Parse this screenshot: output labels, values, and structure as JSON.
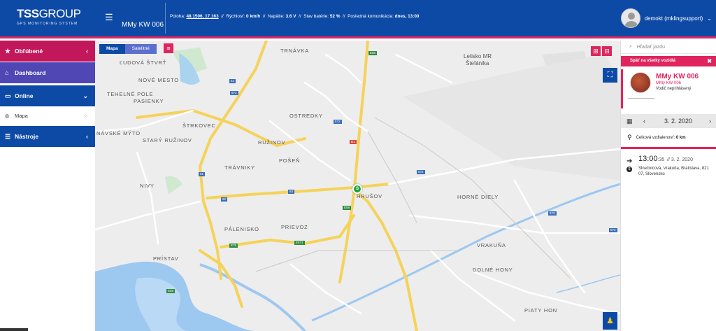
{
  "header": {
    "logo_main": "TSS",
    "logo_group": "GROUP",
    "logo_sub": "GPS MONITORING SYSTEM",
    "vehicle": "MMy KW 006",
    "status": {
      "poloha_label": "Poloha:",
      "poloha_value": "48.1506, 17.163",
      "rychlost_label": "Rýchlosť:",
      "rychlost_value": "0 km/h",
      "napatie_label": "Napätie:",
      "napatie_value": "3.6 V",
      "bateria_label": "Stav batérie:",
      "bateria_value": "52 %",
      "komunikacia_label": "Posledná komunikácia:",
      "komunikacia_value": "dnes, 13:00",
      "sep": "//"
    },
    "user": "demokt (mklingsupport)"
  },
  "sidebar": {
    "items": [
      {
        "label": "Obľúbené"
      },
      {
        "label": "Dashboard"
      },
      {
        "label": "Online"
      },
      {
        "label": "Mapa"
      },
      {
        "label": "Nástroje"
      }
    ]
  },
  "map": {
    "toggle_map": "Mapa",
    "toggle_sat": "Satelitné",
    "marker": "S",
    "labels": [
      "TRNÁVKA",
      "ĽUDOVÁ ŠTVRŤ",
      "NOVÉ MESTO",
      "TEHELNÉ POLE",
      "PASIENKY",
      "OSTREDKY",
      "ŠTRKOVEC",
      "NÁVSKÉ MÝTO",
      "STARÝ RUŽINOV",
      "RUŽINOV",
      "POŠEŇ",
      "TRÁVNIKY",
      "NIVY",
      "HRUŠOV",
      "HORNÉ DIELY",
      "PÁLENISKO",
      "PRIEVOZ",
      "PRÍSTAV",
      "VRAKUŇA",
      "DOLNÉ HONY",
      "PIATY HON",
      "Letisko MR",
      "Štefánika"
    ],
    "shields": [
      "E58",
      "61",
      "572",
      "63",
      "62",
      "E75",
      "E571",
      "E58",
      "572",
      "572",
      "572",
      "D1",
      "61",
      "572",
      "E58"
    ]
  },
  "right_panel": {
    "search_placeholder": "Hľadať jazdu",
    "spat": "Späť na všetky vozidlá",
    "vehicle_name": "MMy KW 006",
    "vehicle_sub": "MMy KW 006",
    "driver": "Vodič neprihlásený",
    "date": "3. 2. 2020",
    "distance_label": "Celková vzdialenosť:",
    "distance_value": "0 km",
    "trip_time": "13:00",
    "trip_seconds": ":35",
    "trip_date": "// 3. 2. 2020",
    "trip_address": "Slnečnicová, Vrakuňa, Bratislava, 821 07, Slovensko"
  },
  "colors": {
    "brand_blue": "#0d4aa5",
    "accent_pink": "#e0245e",
    "dashboard_purple": "#5046b4",
    "favourites_magenta": "#c2185b",
    "marker_green": "#1aa33c"
  }
}
